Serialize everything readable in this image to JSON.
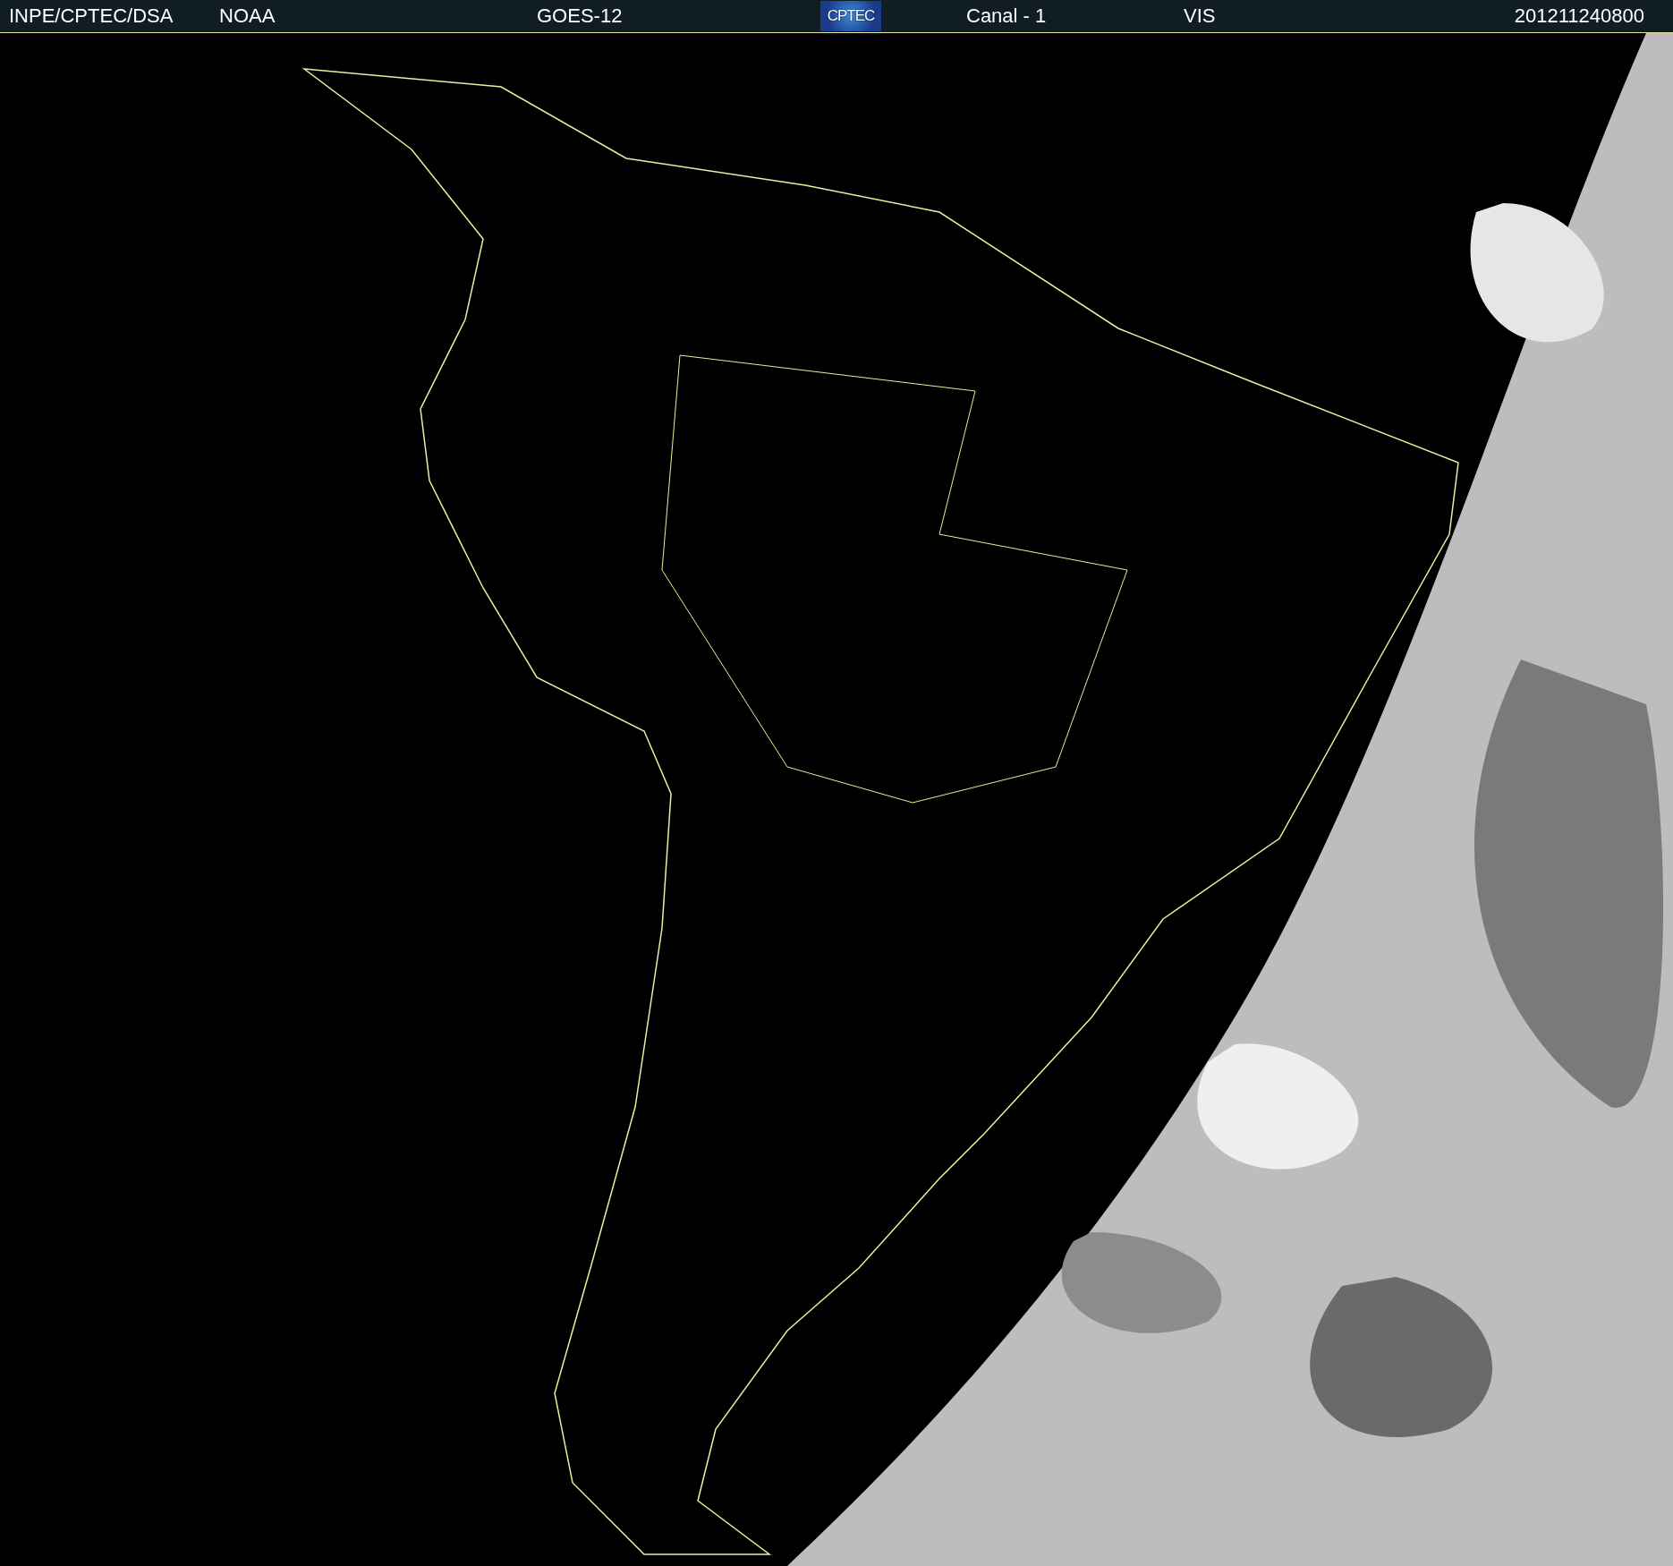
{
  "header": {
    "source": "INPE/CPTEC/DSA",
    "agency": "NOAA",
    "satellite": "GOES-12",
    "logo": "CPTEC",
    "channel": "Canal - 1",
    "band": "VIS",
    "timestamp": "201211240800"
  }
}
